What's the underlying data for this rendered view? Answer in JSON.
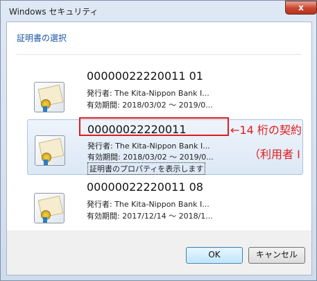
{
  "window": {
    "title": "Windows セキュリティ",
    "close_label": "x"
  },
  "dialog": {
    "heading": "証明書の選択"
  },
  "certificates": [
    {
      "name": "00000022220011 01",
      "issuer": "発行者: The Kita-Nippon Bank I...",
      "validity": "有効期間: 2018/03/02 ～ 2019/0..."
    },
    {
      "name": "00000022220011",
      "issuer": "発行者: The Kita-Nippon Bank I...",
      "validity": "有効期間: 2018/03/02 ～ 2019/0...",
      "properties_link": "証明書のプロパティを表示します"
    },
    {
      "name": "00000022220011 08",
      "issuer": "発行者: The Kita-Nippon Bank I...",
      "validity": "有効期間: 2017/12/14 ～ 2018/1..."
    }
  ],
  "annotation": {
    "line1": "←14 桁の契約",
    "line2": "（利用者 I"
  },
  "buttons": {
    "ok": "OK",
    "cancel": "キャンセル"
  },
  "colors": {
    "annotation": "#e01b1b",
    "heading": "#1b54a6",
    "selection": "#dce8f6"
  }
}
